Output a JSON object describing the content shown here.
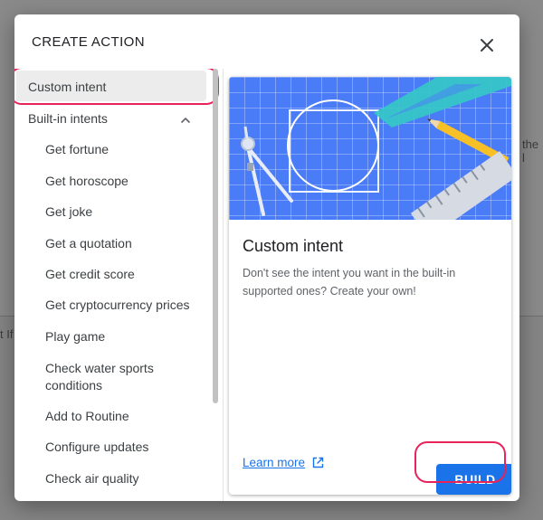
{
  "background": {
    "partial_text_right": "the l",
    "partial_text_left": "t If"
  },
  "dialog": {
    "title": "CREATE ACTION",
    "close_icon": "close-icon"
  },
  "sidebar": {
    "selected_item": "Custom intent",
    "section_label": "Built-in intents",
    "section_icon": "chevron-up-icon",
    "items": [
      "Get fortune",
      "Get horoscope",
      "Get joke",
      "Get a quotation",
      "Get credit score",
      "Get cryptocurrency prices",
      "Play game",
      "Check water sports conditions",
      "Add to Routine",
      "Configure updates",
      "Check air quality"
    ]
  },
  "card": {
    "title": "Custom intent",
    "description": "Don't see the intent you want in the built-in supported ones? Create your own!",
    "learn_more": "Learn more",
    "learn_more_icon": "open-in-new-icon",
    "build_label": "BUILD"
  },
  "colors": {
    "accent": "#1a73e8",
    "highlight": "#e8235a",
    "hero_blue": "#4a7cf7"
  }
}
